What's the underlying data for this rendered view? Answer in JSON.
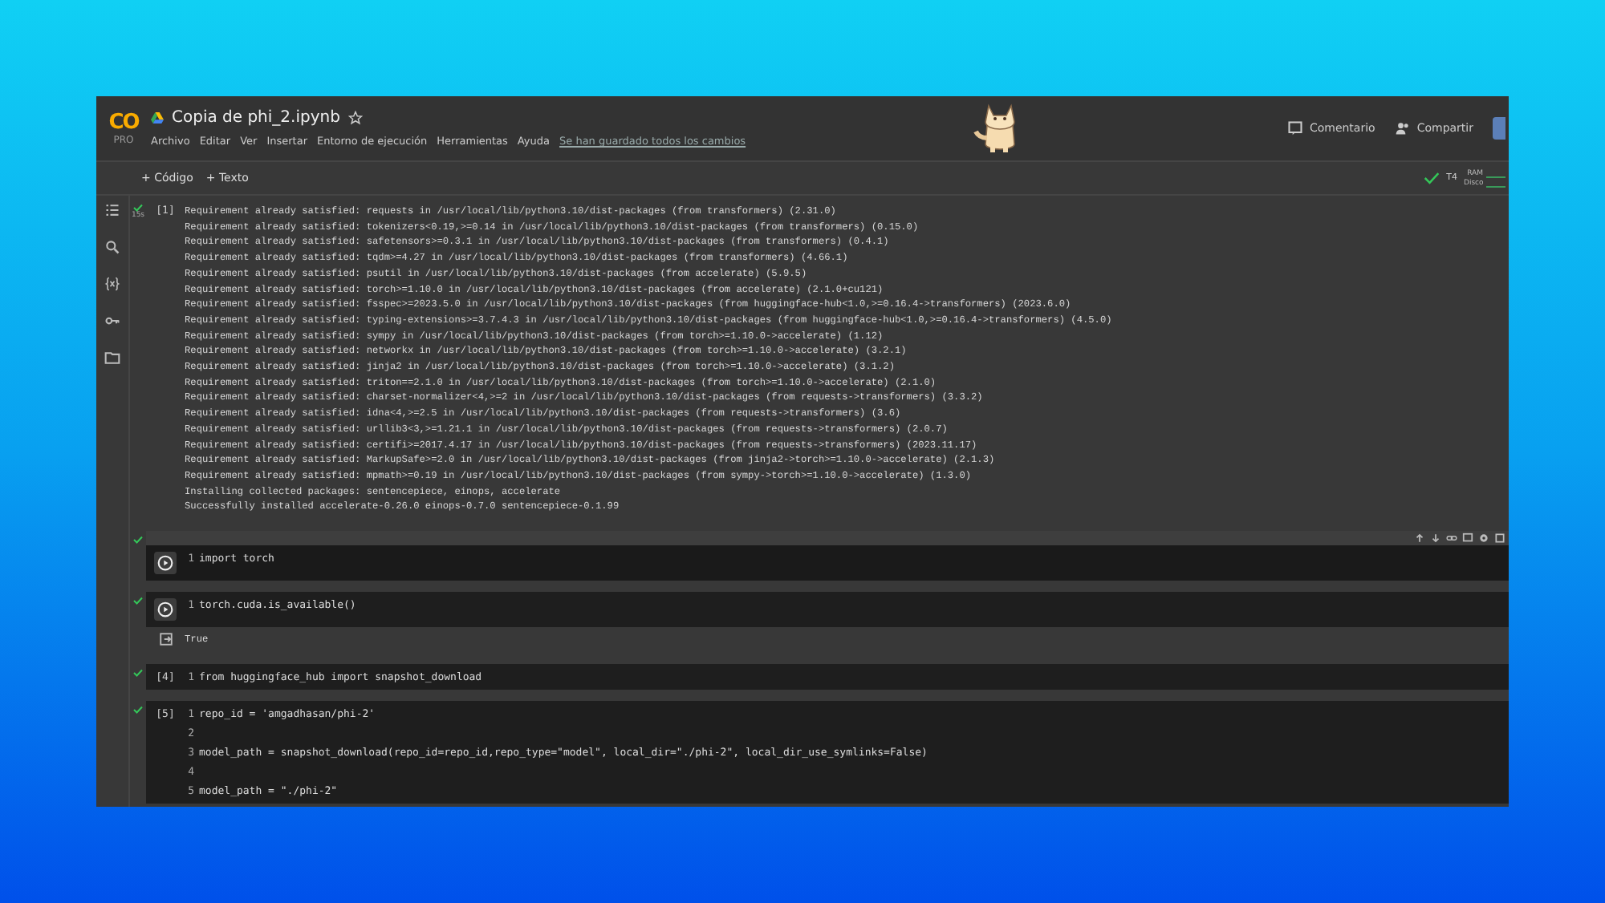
{
  "window": {
    "logo": "CO",
    "plan": "PRO",
    "title": "Copia de phi_2.ipynb",
    "starred": false
  },
  "menu": [
    "Archivo",
    "Editar",
    "Ver",
    "Insertar",
    "Entorno de ejecución",
    "Herramientas",
    "Ayuda"
  ],
  "save_status": "Se han guardado todos los cambios",
  "header_buttons": [
    {
      "kind": "comment",
      "label": "Comentario"
    },
    {
      "kind": "share",
      "label": "Compartir"
    }
  ],
  "toolbar": {
    "add_buttons": [
      "+ Código",
      "+ Texto"
    ],
    "runtime": "T4",
    "ram_label": "RAM",
    "disk_label": "Disco"
  },
  "cells": [
    {
      "prompt": "[1]",
      "time": "15s",
      "selected": false,
      "output": [
        "Requirement already satisfied: requests in /usr/local/lib/python3.10/dist-packages (from transformers) (2.31.0)",
        "Requirement already satisfied: tokenizers<0.19,>=0.14 in /usr/local/lib/python3.10/dist-packages (from transformers) (0.15.0)",
        "Requirement already satisfied: safetensors>=0.3.1 in /usr/local/lib/python3.10/dist-packages (from transformers) (0.4.1)",
        "Requirement already satisfied: tqdm>=4.27 in /usr/local/lib/python3.10/dist-packages (from transformers) (4.66.1)",
        "Requirement already satisfied: psutil in /usr/local/lib/python3.10/dist-packages (from accelerate) (5.9.5)",
        "Requirement already satisfied: torch>=1.10.0 in /usr/local/lib/python3.10/dist-packages (from accelerate) (2.1.0+cu121)",
        "Requirement already satisfied: fsspec>=2023.5.0 in /usr/local/lib/python3.10/dist-packages (from huggingface-hub<1.0,>=0.16.4->transformers) (2023.6.0)",
        "Requirement already satisfied: typing-extensions>=3.7.4.3 in /usr/local/lib/python3.10/dist-packages (from huggingface-hub<1.0,>=0.16.4->transformers) (4.5.0)",
        "Requirement already satisfied: sympy in /usr/local/lib/python3.10/dist-packages (from torch>=1.10.0->accelerate) (1.12)",
        "Requirement already satisfied: networkx in /usr/local/lib/python3.10/dist-packages (from torch>=1.10.0->accelerate) (3.2.1)",
        "Requirement already satisfied: jinja2 in /usr/local/lib/python3.10/dist-packages (from torch>=1.10.0->accelerate) (3.1.2)",
        "Requirement already satisfied: triton==2.1.0 in /usr/local/lib/python3.10/dist-packages (from torch>=1.10.0->accelerate) (2.1.0)",
        "Requirement already satisfied: charset-normalizer<4,>=2 in /usr/local/lib/python3.10/dist-packages (from requests->transformers) (3.3.2)",
        "Requirement already satisfied: idna<4,>=2.5 in /usr/local/lib/python3.10/dist-packages (from requests->transformers) (3.6)",
        "Requirement already satisfied: urllib3<3,>=1.21.1 in /usr/local/lib/python3.10/dist-packages (from requests->transformers) (2.0.7)",
        "Requirement already satisfied: certifi>=2017.4.17 in /usr/local/lib/python3.10/dist-packages (from requests->transformers) (2023.11.17)",
        "Requirement already satisfied: MarkupSafe>=2.0 in /usr/local/lib/python3.10/dist-packages (from jinja2->torch>=1.10.0->accelerate) (2.1.3)",
        "Requirement already satisfied: mpmath>=0.19 in /usr/local/lib/python3.10/dist-packages (from sympy->torch>=1.10.0->accelerate) (1.3.0)",
        "Installing collected packages: sentencepiece, einops, accelerate",
        "Successfully installed accelerate-0.26.0 einops-0.7.0 sentencepiece-0.1.99"
      ]
    },
    {
      "selected": true,
      "lines": [
        {
          "number": "1",
          "code": "import torch"
        }
      ]
    },
    {
      "selected": false,
      "lines": [
        {
          "number": "1",
          "code": "torch.cuda.is_available()"
        }
      ],
      "output": [
        "True"
      ]
    },
    {
      "prompt": "[4]",
      "selected": false,
      "lines": [
        {
          "number": "1",
          "code": "from huggingface_hub import snapshot_download"
        }
      ]
    },
    {
      "prompt": "[5]",
      "selected": false,
      "lines": [
        {
          "number": "1",
          "code": "repo_id = 'amgadhasan/phi-2'"
        },
        {
          "number": "2"
        },
        {
          "number": "3",
          "code": "model_path = snapshot_download(repo_id=repo_id,repo_type=\"model\", local_dir=\"./phi-2\", local_dir_use_symlinks=False)"
        },
        {
          "number": "4"
        },
        {
          "number": "5",
          "code": "model_path = \"./phi-2\""
        }
      ]
    }
  ]
}
